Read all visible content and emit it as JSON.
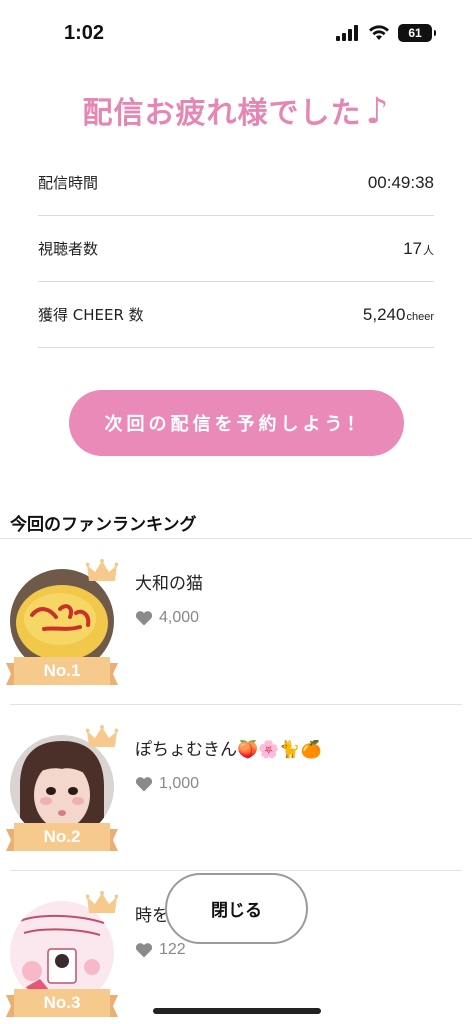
{
  "status_bar": {
    "time": "1:02",
    "battery": "61"
  },
  "title": {
    "text": "配信お疲れ様でした",
    "note": "♪"
  },
  "stats": [
    {
      "label": "配信時間",
      "value": "00:49:38",
      "unit": ""
    },
    {
      "label": "視聴者数",
      "value": "17",
      "unit": "人"
    },
    {
      "label": "獲得 CHEER 数",
      "value": "5,240",
      "unit": "cheer"
    }
  ],
  "reserve_button": "次回の配信を予約しよう！",
  "ranking": {
    "title": "今回のファンランキング",
    "items": [
      {
        "rank": "No.1",
        "name": "大和の猫",
        "score": "4,000"
      },
      {
        "rank": "No.2",
        "name": "ぽちょむきん🍑🌸🐈🍊",
        "score": "1,000"
      },
      {
        "rank": "No.3",
        "name": "時を",
        "score": "122"
      }
    ]
  },
  "close_button": "閉じる",
  "colors": {
    "accent": "#ea8ab9",
    "title": "#e587b5",
    "badge": "#f6c98d",
    "heart": "#8a8a8a"
  }
}
